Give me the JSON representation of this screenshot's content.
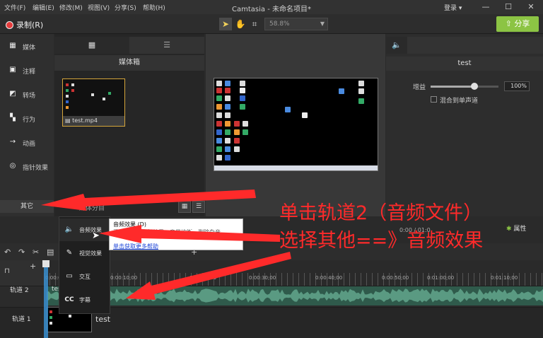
{
  "menu": {
    "items": [
      "文件(F)",
      "编辑(E)",
      "修改(M)",
      "视图(V)",
      "分享(S)",
      "帮助(H)"
    ],
    "app_title": "Camtasia - 未命名项目*",
    "login": "登录 ▾"
  },
  "window_buttons": [
    "—",
    "☐",
    "✕"
  ],
  "toolbar": {
    "record_label": "录制(R)",
    "zoom_value": "58.8%",
    "share_label": "⇧ 分享"
  },
  "sidebar": {
    "items": [
      {
        "label": "媒体",
        "icon": "film-icon"
      },
      {
        "label": "注释",
        "icon": "annotation-icon"
      },
      {
        "label": "转场",
        "icon": "transition-icon"
      },
      {
        "label": "行为",
        "icon": "behavior-icon"
      },
      {
        "label": "动画",
        "icon": "animation-icon"
      },
      {
        "label": "指针效果",
        "icon": "cursor-effect-icon"
      }
    ],
    "other_label": "其它"
  },
  "media_bin": {
    "title": "媒体箱",
    "clip_name": "test.mp4",
    "sort_label": "媒体分目"
  },
  "properties": {
    "title": "test",
    "gain_label": "增益",
    "gain_value": "100%",
    "gain_fraction": 0.65,
    "mix_label": "混合到单声道",
    "button_label": "属性"
  },
  "timecode": "0:00 / 01:0",
  "timeline": {
    "ruler_labels": [
      "0:00:00;00",
      "0:00:10;00",
      "0:00:20;00",
      "0:00:30;00",
      "0:00:40;00",
      "0:00:50;00",
      "0:01:00;00",
      "0:01:10;00"
    ],
    "track2": {
      "label": "轨道 2",
      "clip": "test"
    },
    "track1": {
      "label": "轨道 1",
      "clip": "test"
    }
  },
  "popup_menu": {
    "items": [
      {
        "label": "音频效果",
        "icon": "speaker-icon"
      },
      {
        "label": "视觉效果",
        "icon": "wand-icon"
      },
      {
        "label": "交互",
        "icon": "interaction-icon"
      },
      {
        "label": "字幕",
        "icon": "cc-icon"
      }
    ]
  },
  "tooltip": {
    "title": "音频效果 (D)",
    "description": "添加和修改音频效果，音量均衡、删除杂音",
    "link": "单击获取更多帮助"
  },
  "annotation": {
    "line1": "单击轨道2（音频文件）",
    "line2": "选择其他==》音频效果",
    "color": "#ff2a2a"
  }
}
